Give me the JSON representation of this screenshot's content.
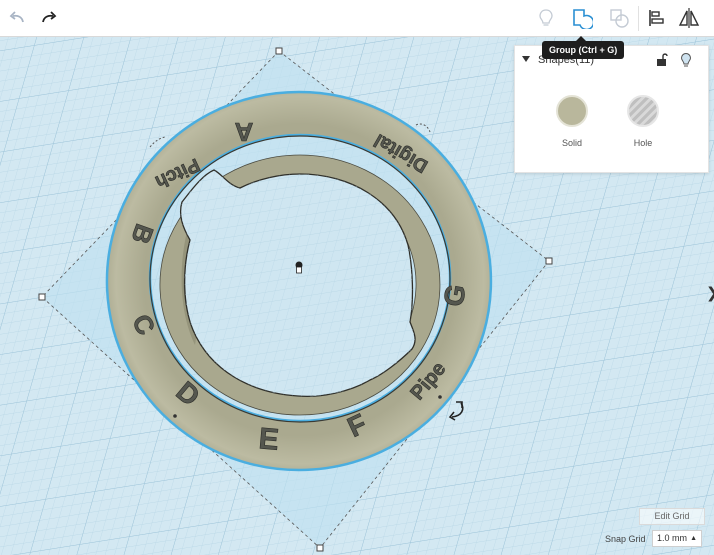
{
  "toolbar": {
    "undo_icon": "undo-arrow-icon",
    "redo_icon": "redo-arrow-icon",
    "tools": [
      {
        "name": "show-all-icon",
        "active": false
      },
      {
        "name": "group-icon",
        "active": true
      },
      {
        "name": "ungroup-icon",
        "active": false
      },
      {
        "name": "align-icon",
        "active": true
      },
      {
        "name": "mirror-icon",
        "active": true
      }
    ],
    "tooltip": "Group (Ctrl + G)"
  },
  "shapes_panel": {
    "title": "Shapes(11)",
    "solid_label": "Solid",
    "hole_label": "Hole",
    "solid_color": "#b9b79c"
  },
  "ring": {
    "labels": [
      "A",
      "Pitch",
      "B",
      "C",
      "D",
      "E",
      "F",
      "Pipe",
      "G",
      "Digital"
    ],
    "color": "#b8b79d",
    "highlight": "#4aaee0"
  },
  "grid": {
    "edit_label": "Edit Grid",
    "snap_label": "Snap Grid",
    "snap_value": "1.0 mm",
    "background": "#cfe6f1"
  }
}
